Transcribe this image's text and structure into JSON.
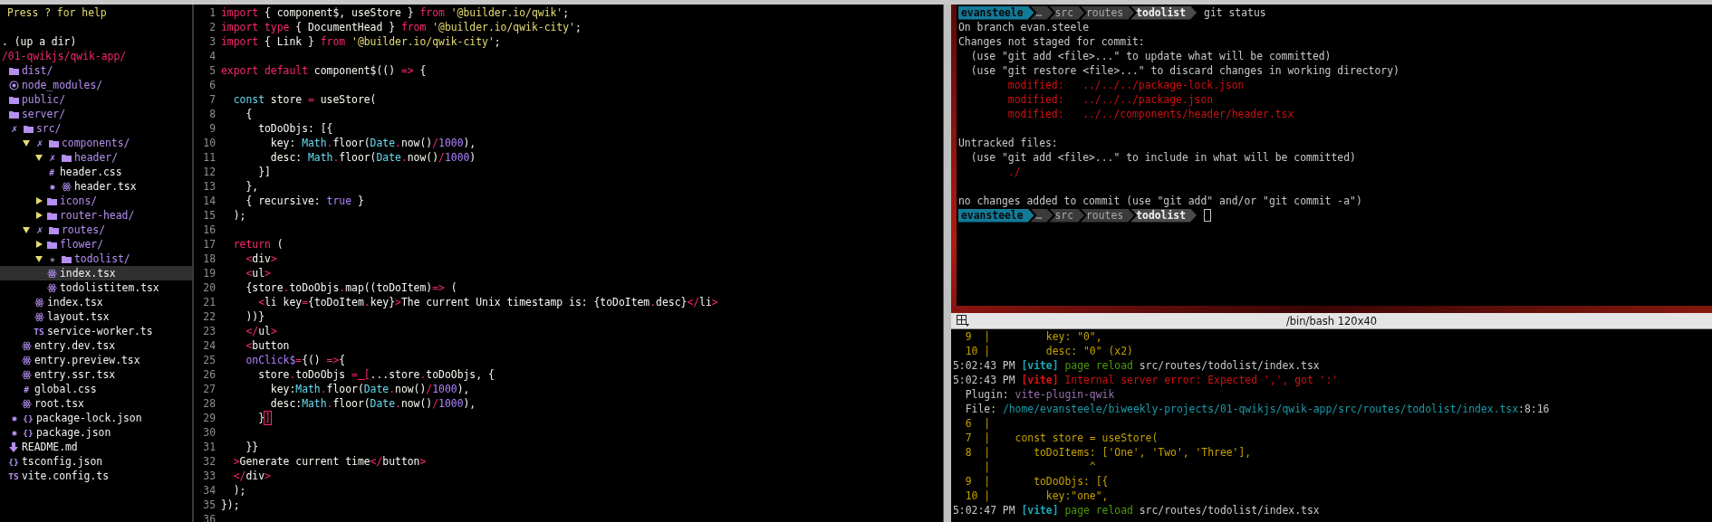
{
  "tree": {
    "help": "Press ? for help",
    "up": ". (up a dir)",
    "root": "/01-qwikjs/qwik-app/",
    "items": [
      {
        "name": "dist/",
        "kind": "folder",
        "selected": false
      },
      {
        "name": "node_modules/",
        "kind": "module",
        "selected": false
      },
      {
        "name": "public/",
        "kind": "folder",
        "selected": false
      },
      {
        "name": "server/",
        "kind": "folder",
        "selected": false
      },
      {
        "name": "src/",
        "kind": "folder",
        "git_mark": "✗",
        "selected": false,
        "children": [
          {
            "name": "components/",
            "kind": "folder",
            "expanded": true,
            "git_mark": "✗",
            "selected": false,
            "children": [
              {
                "name": "header/",
                "kind": "folder",
                "expanded": true,
                "git_mark": "✗",
                "selected": false,
                "children": [
                  {
                    "name": "header.css",
                    "kind": "glyph",
                    "glyph": "#",
                    "selected": false
                  },
                  {
                    "name": "header.tsx",
                    "kind": "react",
                    "git_mark": "✹",
                    "selected": false
                  }
                ]
              },
              {
                "name": "icons/",
                "kind": "folder",
                "expanded": false,
                "selected": false
              },
              {
                "name": "router-head/",
                "kind": "folder",
                "expanded": false,
                "selected": false
              }
            ]
          },
          {
            "name": "routes/",
            "kind": "folder",
            "expanded": true,
            "git_mark": "✗",
            "selected": false,
            "children": [
              {
                "name": "flower/",
                "kind": "folder",
                "expanded": false,
                "selected": false
              },
              {
                "name": "todolist/",
                "kind": "folder",
                "expanded": true,
                "git_mark": "★",
                "selected": false,
                "children": [
                  {
                    "name": "index.tsx",
                    "kind": "react",
                    "selected": true
                  },
                  {
                    "name": "todolistitem.tsx",
                    "kind": "react",
                    "selected": false
                  }
                ]
              },
              {
                "name": "index.tsx",
                "kind": "react",
                "selected": false
              },
              {
                "name": "layout.tsx",
                "kind": "react",
                "selected": false
              },
              {
                "name": "service-worker.ts",
                "kind": "glyph",
                "glyph": "TS",
                "selected": false
              }
            ]
          },
          {
            "name": "entry.dev.tsx",
            "kind": "react",
            "selected": false
          },
          {
            "name": "entry.preview.tsx",
            "kind": "react",
            "selected": false
          },
          {
            "name": "entry.ssr.tsx",
            "kind": "react",
            "selected": false
          },
          {
            "name": "global.css",
            "kind": "glyph",
            "glyph": "#",
            "selected": false
          },
          {
            "name": "root.tsx",
            "kind": "react",
            "selected": false
          }
        ]
      },
      {
        "name": "package-lock.json",
        "kind": "glyph",
        "glyph": "{}",
        "git_mark": "✹",
        "selected": false
      },
      {
        "name": "package.json",
        "kind": "glyph",
        "glyph": "{}",
        "git_mark": "✹",
        "selected": false
      },
      {
        "name": "README.md",
        "kind": "markdown",
        "selected": false
      },
      {
        "name": "tsconfig.json",
        "kind": "glyph",
        "glyph": "{}",
        "selected": false
      },
      {
        "name": "vite.config.ts",
        "kind": "glyph",
        "glyph": "TS",
        "selected": false
      }
    ]
  },
  "editor": {
    "lines": [
      {
        "number": "1",
        "tokens": [
          {
            "kind": "kw",
            "text": "import"
          },
          {
            "kind": "plain",
            "text": " { component$, useStore } "
          },
          {
            "kind": "kw",
            "text": "from"
          },
          {
            "kind": "str",
            "text": " '@builder.io/qwik'"
          },
          {
            "kind": "plain",
            "text": ";"
          }
        ]
      },
      {
        "number": "2",
        "tokens": [
          {
            "kind": "kw",
            "text": "import type"
          },
          {
            "kind": "plain",
            "text": " { DocumentHead } "
          },
          {
            "kind": "kw",
            "text": "from"
          },
          {
            "kind": "str",
            "text": " '@builder.io/qwik-city'"
          },
          {
            "kind": "plain",
            "text": ";"
          }
        ]
      },
      {
        "number": "3",
        "tokens": [
          {
            "kind": "kw",
            "text": "import"
          },
          {
            "kind": "plain",
            "text": " { Link } "
          },
          {
            "kind": "kw",
            "text": "from"
          },
          {
            "kind": "str",
            "text": " '@builder.io/qwik-city'"
          },
          {
            "kind": "plain",
            "text": ";"
          }
        ]
      },
      {
        "number": "4"
      },
      {
        "number": "5",
        "tokens": [
          {
            "kind": "kw",
            "text": "export default"
          },
          {
            "kind": "plain",
            "text": " component$(() "
          },
          {
            "kind": "kw",
            "text": "=>"
          },
          {
            "kind": "plain",
            "text": " {"
          }
        ]
      },
      {
        "number": "6"
      },
      {
        "number": "7",
        "tokens": [
          {
            "kind": "type",
            "text": "  const"
          },
          {
            "kind": "plain",
            "text": " store "
          },
          {
            "kind": "kw",
            "text": "="
          },
          {
            "kind": "plain",
            "text": " useStore("
          }
        ]
      },
      {
        "number": "8",
        "tokens": [
          {
            "kind": "plain",
            "text": "    {"
          }
        ]
      },
      {
        "number": "9",
        "tokens": [
          {
            "kind": "plain",
            "text": "      toDoObjs: [{"
          }
        ]
      },
      {
        "number": "10",
        "tokens": [
          {
            "kind": "plain",
            "text": "        key: "
          },
          {
            "kind": "type",
            "text": "Math"
          },
          {
            "kind": "kw",
            "text": "."
          },
          {
            "kind": "plain",
            "text": "floor("
          },
          {
            "kind": "type",
            "text": "Date"
          },
          {
            "kind": "kw",
            "text": "."
          },
          {
            "kind": "plain",
            "text": "now()"
          },
          {
            "kind": "kw",
            "text": "/"
          },
          {
            "kind": "num",
            "text": "1000"
          },
          {
            "kind": "plain",
            "text": "),"
          }
        ]
      },
      {
        "number": "11",
        "tokens": [
          {
            "kind": "plain",
            "text": "        desc: "
          },
          {
            "kind": "type",
            "text": "Math"
          },
          {
            "kind": "kw",
            "text": "."
          },
          {
            "kind": "plain",
            "text": "floor("
          },
          {
            "kind": "type",
            "text": "Date"
          },
          {
            "kind": "kw",
            "text": "."
          },
          {
            "kind": "plain",
            "text": "now()"
          },
          {
            "kind": "kw",
            "text": "/"
          },
          {
            "kind": "num",
            "text": "1000"
          },
          {
            "kind": "plain",
            "text": ")"
          }
        ]
      },
      {
        "number": "12",
        "tokens": [
          {
            "kind": "plain",
            "text": "      }]"
          }
        ]
      },
      {
        "number": "13",
        "tokens": [
          {
            "kind": "plain",
            "text": "    },"
          }
        ]
      },
      {
        "number": "14",
        "tokens": [
          {
            "kind": "plain",
            "text": "    { recursive: "
          },
          {
            "kind": "num",
            "text": "true"
          },
          {
            "kind": "plain",
            "text": " }"
          }
        ]
      },
      {
        "number": "15",
        "tokens": [
          {
            "kind": "plain",
            "text": "  );"
          }
        ]
      },
      {
        "number": "16"
      },
      {
        "number": "17",
        "tokens": [
          {
            "kind": "kw",
            "text": "  return"
          },
          {
            "kind": "plain",
            "text": " ("
          }
        ]
      },
      {
        "number": "18",
        "tokens": [
          {
            "kind": "kw",
            "text": "    <"
          },
          {
            "kind": "plain",
            "text": "div"
          },
          {
            "kind": "kw",
            "text": ">"
          }
        ]
      },
      {
        "number": "19",
        "tokens": [
          {
            "kind": "kw",
            "text": "    <"
          },
          {
            "kind": "plain",
            "text": "ul"
          },
          {
            "kind": "kw",
            "text": ">"
          }
        ]
      },
      {
        "number": "20",
        "tokens": [
          {
            "kind": "plain",
            "text": "    {store"
          },
          {
            "kind": "kw",
            "text": "."
          },
          {
            "kind": "plain",
            "text": "toDoObjs"
          },
          {
            "kind": "kw",
            "text": "."
          },
          {
            "kind": "plain",
            "text": "map((toDoItem)"
          },
          {
            "kind": "kw",
            "text": "=>"
          },
          {
            "kind": "plain",
            "text": " ("
          }
        ]
      },
      {
        "number": "21",
        "tokens": [
          {
            "kind": "kw",
            "text": "      <"
          },
          {
            "kind": "plain",
            "text": "li key"
          },
          {
            "kind": "kw",
            "text": "="
          },
          {
            "kind": "plain",
            "text": "{toDoItem"
          },
          {
            "kind": "kw",
            "text": "."
          },
          {
            "kind": "plain",
            "text": "key}"
          },
          {
            "kind": "kw",
            "text": ">"
          },
          {
            "kind": "plain",
            "text": "The current Unix timestamp is: {toDoItem"
          },
          {
            "kind": "kw",
            "text": "."
          },
          {
            "kind": "plain",
            "text": "desc}"
          },
          {
            "kind": "kw",
            "text": "</"
          },
          {
            "kind": "plain",
            "text": "li"
          },
          {
            "kind": "kw",
            "text": ">"
          }
        ]
      },
      {
        "number": "22",
        "tokens": [
          {
            "kind": "plain",
            "text": "    ))}"
          }
        ]
      },
      {
        "number": "23",
        "tokens": [
          {
            "kind": "kw",
            "text": "    </"
          },
          {
            "kind": "plain",
            "text": "ul"
          },
          {
            "kind": "kw",
            "text": ">"
          }
        ]
      },
      {
        "number": "24",
        "tokens": [
          {
            "kind": "kw",
            "text": "    <"
          },
          {
            "kind": "plain",
            "text": "button"
          }
        ]
      },
      {
        "number": "25",
        "tokens": [
          {
            "kind": "num",
            "text": "    onClick$"
          },
          {
            "kind": "kw",
            "text": "="
          },
          {
            "kind": "plain",
            "text": "{() "
          },
          {
            "kind": "kw",
            "text": "=>"
          },
          {
            "kind": "plain",
            "text": "{"
          }
        ]
      },
      {
        "number": "26",
        "tokens": [
          {
            "kind": "plain",
            "text": "      store"
          },
          {
            "kind": "kw",
            "text": "."
          },
          {
            "kind": "plain",
            "text": "toDoObjs "
          },
          {
            "kind": "kw",
            "text": "="
          },
          {
            "kind": "match",
            "text": " ["
          },
          {
            "kind": "plain",
            "text": "...store"
          },
          {
            "kind": "kw",
            "text": "."
          },
          {
            "kind": "plain",
            "text": "toDoObjs, {"
          }
        ]
      },
      {
        "number": "27",
        "tokens": [
          {
            "kind": "plain",
            "text": "        key:"
          },
          {
            "kind": "type",
            "text": "Math"
          },
          {
            "kind": "kw",
            "text": "."
          },
          {
            "kind": "plain",
            "text": "floor("
          },
          {
            "kind": "type",
            "text": "Date"
          },
          {
            "kind": "kw",
            "text": "."
          },
          {
            "kind": "plain",
            "text": "now()"
          },
          {
            "kind": "kw",
            "text": "/"
          },
          {
            "kind": "num",
            "text": "1000"
          },
          {
            "kind": "plain",
            "text": "),"
          }
        ]
      },
      {
        "number": "28",
        "tokens": [
          {
            "kind": "plain",
            "text": "        desc:"
          },
          {
            "kind": "type",
            "text": "Math"
          },
          {
            "kind": "kw",
            "text": "."
          },
          {
            "kind": "plain",
            "text": "floor("
          },
          {
            "kind": "type",
            "text": "Date"
          },
          {
            "kind": "kw",
            "text": "."
          },
          {
            "kind": "plain",
            "text": "now()"
          },
          {
            "kind": "kw",
            "text": "/"
          },
          {
            "kind": "num",
            "text": "1000"
          },
          {
            "kind": "plain",
            "text": "),"
          }
        ]
      },
      {
        "number": "29",
        "tokens": [
          {
            "kind": "plain",
            "text": "      }"
          },
          {
            "kind": "cursor",
            "text": "]"
          }
        ]
      },
      {
        "number": "30"
      },
      {
        "number": "31",
        "tokens": [
          {
            "kind": "plain",
            "text": "    }}"
          }
        ]
      },
      {
        "number": "32",
        "tokens": [
          {
            "kind": "kw",
            "text": "  >"
          },
          {
            "kind": "plain",
            "text": "Generate current time"
          },
          {
            "kind": "kw",
            "text": "</"
          },
          {
            "kind": "plain",
            "text": "button"
          },
          {
            "kind": "kw",
            "text": ">"
          }
        ]
      },
      {
        "number": "33",
        "tokens": [
          {
            "kind": "kw",
            "text": "  </"
          },
          {
            "kind": "plain",
            "text": "div"
          },
          {
            "kind": "kw",
            "text": ">"
          }
        ]
      },
      {
        "number": "34",
        "tokens": [
          {
            "kind": "plain",
            "text": "  );"
          }
        ]
      },
      {
        "number": "35",
        "tokens": [
          {
            "kind": "plain",
            "text": "});"
          }
        ]
      },
      {
        "number": "36"
      }
    ]
  },
  "terminal_top": {
    "lines": [
      {
        "kind": "prompt",
        "segments": [
          {
            "kind": "user",
            "text": "evansteele"
          },
          {
            "kind": "dir",
            "text": "…"
          },
          {
            "kind": "dir",
            "text": "src"
          },
          {
            "kind": "dir",
            "text": "routes"
          },
          {
            "kind": "current",
            "text": "todolist"
          }
        ],
        "command": "git status",
        "cursor": false
      },
      {
        "kind": "output",
        "tokens": [
          {
            "kind": "gray",
            "text": "On branch evan.steele"
          }
        ]
      },
      {
        "kind": "output",
        "tokens": [
          {
            "kind": "gray",
            "text": "Changes not staged for commit:"
          }
        ]
      },
      {
        "kind": "output",
        "tokens": [
          {
            "kind": "gray",
            "text": "  (use \"git add <file>...\" to update what will be committed)"
          }
        ]
      },
      {
        "kind": "output",
        "tokens": [
          {
            "kind": "gray",
            "text": "  (use \"git restore <file>...\" to discard changes in working directory)"
          }
        ]
      },
      {
        "kind": "output",
        "tokens": [
          {
            "kind": "red",
            "text": "        modified:   ../../../package-lock.json"
          }
        ]
      },
      {
        "kind": "output",
        "tokens": [
          {
            "kind": "red",
            "text": "        modified:   ../../../package.json"
          }
        ]
      },
      {
        "kind": "output",
        "tokens": [
          {
            "kind": "red",
            "text": "        modified:   ../../components/header/header.tsx"
          }
        ]
      },
      {
        "kind": "blank"
      },
      {
        "kind": "output",
        "tokens": [
          {
            "kind": "gray",
            "text": "Untracked files:"
          }
        ]
      },
      {
        "kind": "output",
        "tokens": [
          {
            "kind": "gray",
            "text": "  (use \"git add <file>...\" to include in what will be committed)"
          }
        ]
      },
      {
        "kind": "output",
        "tokens": [
          {
            "kind": "red",
            "text": "        ./"
          }
        ]
      },
      {
        "kind": "blank"
      },
      {
        "kind": "output",
        "tokens": [
          {
            "kind": "gray",
            "text": "no changes added to commit (use \"git add\" and/or \"git commit -a\")"
          }
        ]
      },
      {
        "kind": "prompt",
        "segments": [
          {
            "kind": "user",
            "text": "evansteele"
          },
          {
            "kind": "dir",
            "text": "…"
          },
          {
            "kind": "dir",
            "text": "src"
          },
          {
            "kind": "dir",
            "text": "routes"
          },
          {
            "kind": "current",
            "text": "todolist"
          }
        ],
        "cursor": true
      }
    ]
  },
  "terminal_bottom": {
    "title": "/bin/bash 120x40",
    "lines": [
      {
        "kind": "output",
        "tokens": [
          {
            "kind": "orange",
            "text": "  9  |         key: \"0\","
          }
        ]
      },
      {
        "kind": "output",
        "tokens": [
          {
            "kind": "orange",
            "text": "  10 |         desc: \"0\" (x2)"
          }
        ]
      },
      {
        "kind": "output",
        "tokens": [
          {
            "kind": "gray",
            "text": "5:02:43 PM "
          },
          {
            "kind": "cyan_bold",
            "text": "[vite]"
          },
          {
            "kind": "green",
            "text": " page reload"
          },
          {
            "kind": "gray",
            "text": " src/routes/todolist/index.tsx"
          }
        ]
      },
      {
        "kind": "output",
        "tokens": [
          {
            "kind": "gray",
            "text": "5:02:43 PM "
          },
          {
            "kind": "red_bold",
            "text": "[vite]"
          },
          {
            "kind": "red",
            "text": " Internal server error: Expected ',', got ':'"
          }
        ]
      },
      {
        "kind": "output",
        "tokens": [
          {
            "kind": "gray",
            "text": "  Plugin: "
          },
          {
            "kind": "purple",
            "text": "vite-plugin-qwik"
          }
        ]
      },
      {
        "kind": "output",
        "tokens": [
          {
            "kind": "gray",
            "text": "  File: "
          },
          {
            "kind": "cyan",
            "text": "/home/evansteele/biweekly-projects/01-qwikjs/qwik-app/src/routes/todolist/index.tsx"
          },
          {
            "kind": "gray",
            "text": ":8:16"
          }
        ]
      },
      {
        "kind": "output",
        "tokens": [
          {
            "kind": "orange",
            "text": "  6  |"
          }
        ]
      },
      {
        "kind": "output",
        "tokens": [
          {
            "kind": "orange",
            "text": "  7  |    const store = useStore("
          }
        ]
      },
      {
        "kind": "output",
        "tokens": [
          {
            "kind": "orange",
            "text": "  8  |       toDoItems: ['One', 'Two', 'Three'],"
          }
        ]
      },
      {
        "kind": "output",
        "tokens": [
          {
            "kind": "orange",
            "text": "     |                ^"
          }
        ]
      },
      {
        "kind": "output",
        "tokens": [
          {
            "kind": "orange",
            "text": "  9  |       toDoObjs: [{"
          }
        ]
      },
      {
        "kind": "output",
        "tokens": [
          {
            "kind": "orange",
            "text": "  10 |         key:\"one\","
          }
        ]
      },
      {
        "kind": "output",
        "tokens": [
          {
            "kind": "gray",
            "text": "5:02:47 PM "
          },
          {
            "kind": "cyan_bold",
            "text": "[vite]"
          },
          {
            "kind": "green",
            "text": " page reload"
          },
          {
            "kind": "gray",
            "text": " src/routes/todolist/index.tsx"
          }
        ]
      }
    ]
  }
}
